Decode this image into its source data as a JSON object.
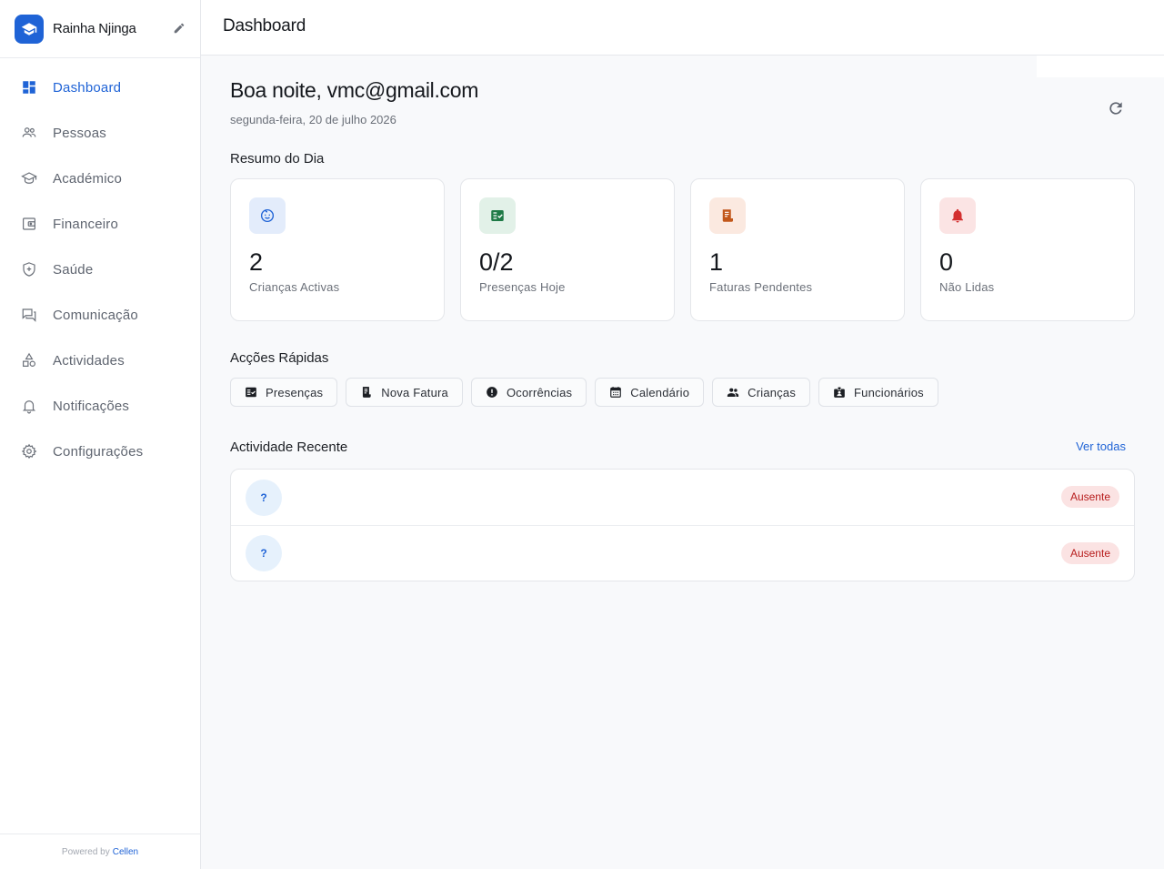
{
  "sidebar": {
    "school_name": "Rainha Njinga",
    "items": [
      {
        "label": "Dashboard",
        "icon": "dashboard-icon",
        "active": true
      },
      {
        "label": "Pessoas",
        "icon": "people-icon"
      },
      {
        "label": "Académico",
        "icon": "graduation-cap-icon"
      },
      {
        "label": "Financeiro",
        "icon": "wallet-icon"
      },
      {
        "label": "Saúde",
        "icon": "health-shield-icon"
      },
      {
        "label": "Comunicação",
        "icon": "chat-icon"
      },
      {
        "label": "Actividades",
        "icon": "shapes-icon"
      },
      {
        "label": "Notificações",
        "icon": "bell-icon"
      },
      {
        "label": "Configurações",
        "icon": "gear-icon"
      }
    ],
    "footer": {
      "prefix": "Powered by",
      "brand": "Cellen"
    }
  },
  "topbar": {
    "title": "Dashboard"
  },
  "main": {
    "greeting": "Boa noite, vmc@gmail.com",
    "date": "segunda-feira, 20 de julho 2026",
    "summary_title": "Resumo do Dia",
    "cards": [
      {
        "value": "2",
        "label": "Crianças Activas",
        "icon": "child-face-icon",
        "color": "#1f63d6",
        "bg": "#e3ecfb"
      },
      {
        "value": "0/2",
        "label": "Presenças Hoje",
        "icon": "fact-check-icon",
        "color": "#1e7a46",
        "bg": "#e2f1e8"
      },
      {
        "value": "1",
        "label": "Faturas Pendentes",
        "icon": "receipt-icon",
        "color": "#c2571a",
        "bg": "#fbe9e0"
      },
      {
        "value": "0",
        "label": "Não Lidas",
        "icon": "bell-icon",
        "color": "#d32f2f",
        "bg": "#fbe4e4"
      }
    ],
    "quick_title": "Acções Rápidas",
    "quick_actions": [
      {
        "label": "Presenças",
        "icon": "fact-check-icon"
      },
      {
        "label": "Nova Fatura",
        "icon": "receipt-icon"
      },
      {
        "label": "Ocorrências",
        "icon": "alert-circle-icon"
      },
      {
        "label": "Calendário",
        "icon": "calendar-icon"
      },
      {
        "label": "Crianças",
        "icon": "people-icon"
      },
      {
        "label": "Funcionários",
        "icon": "badge-icon"
      }
    ],
    "recent_title": "Actividade Recente",
    "see_all": "Ver todas",
    "recent": [
      {
        "avatar": "?",
        "status": "Ausente"
      },
      {
        "avatar": "?",
        "status": "Ausente"
      }
    ]
  }
}
